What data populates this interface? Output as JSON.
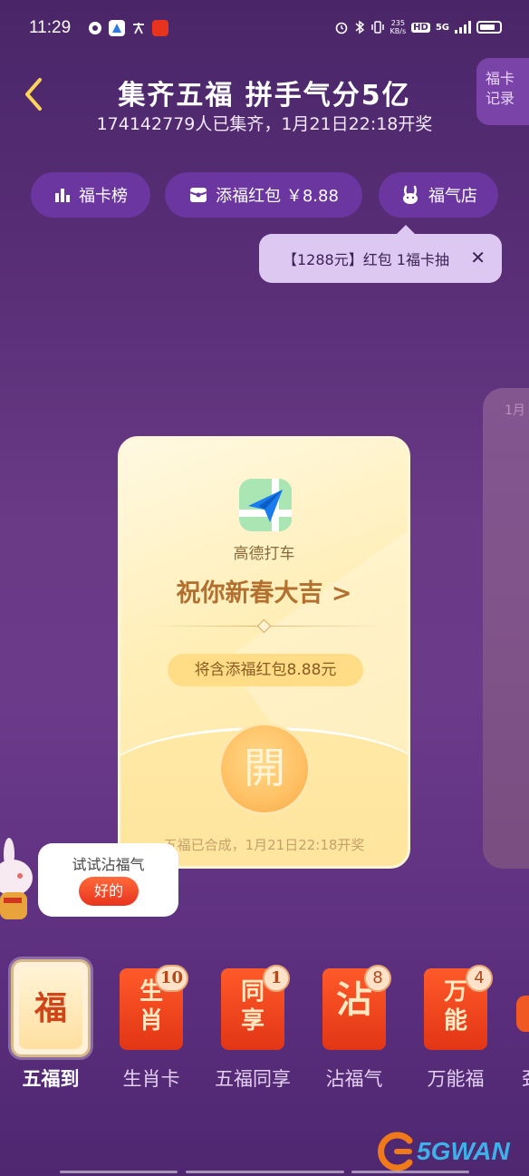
{
  "status_bar": {
    "time": "11:29",
    "net_speed_value": "235",
    "net_speed_unit": "KB/s",
    "hd_label": "HD",
    "signal_label": "5G"
  },
  "header": {
    "title": "集齐五福 拼手气分5亿",
    "subtitle": "174142779人已集齐，1月21日22:18开奖",
    "record_button": "福卡\n记录"
  },
  "pills": {
    "rank": "福卡榜",
    "red_packet": "添福红包 ￥8.88",
    "shop": "福气店"
  },
  "tooltip": {
    "text": "【1288元】红包 1福卡抽",
    "close": "✕"
  },
  "side_card": {
    "text": "1月"
  },
  "main_card": {
    "app_name": "高德打车",
    "wish": "祝你新春大吉 >",
    "bonus": "将含添福红包8.88元",
    "open_label": "開",
    "footer": "五福已合成，1月21日22:18开奖"
  },
  "bubble": {
    "text": "试试沾福气",
    "button": "好的"
  },
  "tabs": {
    "active": {
      "glyph": "福",
      "label": "五福到"
    },
    "items": [
      {
        "card": "生\n肖",
        "badge": "10",
        "label": "生肖卡"
      },
      {
        "card": "同\n享",
        "badge": "1",
        "label": "五福同享"
      },
      {
        "card": "沾",
        "badge": "8",
        "label": "沾福气"
      },
      {
        "card": "万\n能",
        "badge": "4",
        "label": "万能福"
      }
    ],
    "edge_label": "劲"
  },
  "watermark": {
    "text": "5GWAN"
  },
  "colors": {
    "accent_red": "#e8331f",
    "pill_bg": "#6c36a0",
    "card_gold": "#ffe7a4"
  }
}
